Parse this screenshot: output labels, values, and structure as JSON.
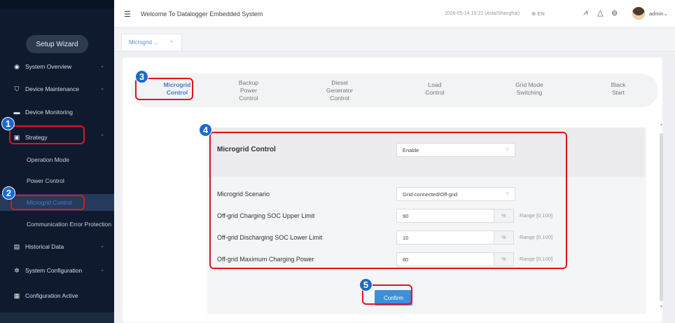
{
  "sidebar": {
    "wizard_label": "Setup Wizard",
    "items": [
      {
        "icon": "gauge-icon",
        "label": "System Overview",
        "chev": "⌄"
      },
      {
        "icon": "shield-icon",
        "label": "Device Maintenance",
        "chev": "⌄"
      },
      {
        "icon": "monitor-icon",
        "label": "Device Monitoring",
        "chev": ""
      },
      {
        "icon": "strategy-icon",
        "label": "Strategy",
        "chev": "⌃"
      },
      {
        "icon": "chart-icon",
        "label": "Historical Data",
        "chev": "⌄"
      },
      {
        "icon": "gear-icon",
        "label": "System Configuration",
        "chev": "⌄"
      },
      {
        "icon": "document-icon",
        "label": "Configuration Active",
        "chev": ""
      }
    ],
    "sub_items": [
      "Operation Mode",
      "Power Control",
      "Microgrid Control",
      "Communication Error Protection"
    ]
  },
  "header": {
    "title": "Welcome To Datalogger Embedded System",
    "datetime": "2026-05-14 15:21 (Asia/Shanghai)",
    "lang": "EN",
    "user": "admin"
  },
  "tabs": {
    "open_tab": "Microgrid ..."
  },
  "subtabs": [
    {
      "label": "Microgrid\nControl",
      "active": true
    },
    {
      "label": "Backup\nPower\nControl",
      "active": false
    },
    {
      "label": "Diesel\nGenerator\nControl",
      "active": false
    },
    {
      "label": "Load\nControl",
      "active": false
    },
    {
      "label": "Grid Mode\nSwitching",
      "active": false
    },
    {
      "label": "Black\nStart",
      "active": false
    }
  ],
  "form": {
    "heading": "Microgrid Control",
    "enable_value": "Enable",
    "scenario_label": "Microgrid Scenario",
    "scenario_value": "Grid-connected/Off-grid",
    "upper_label": "Off-grid Charging SOC Upper Limit",
    "upper_value": "90",
    "lower_label": "Off-grid Discharging SOC Lower Limit",
    "lower_value": "10",
    "max_label": "Off-grid Maximum Charging Power",
    "max_value": "80",
    "unit": "%",
    "range": "Range [0,100]",
    "confirm_label": "Confirm"
  },
  "annotations": [
    "1",
    "2",
    "3",
    "4",
    "5"
  ],
  "colors": {
    "accent": "#3f8ed8",
    "highlight": "#e0141e",
    "badge": "#1b69cf",
    "sidebar": "#0f1a2e"
  }
}
